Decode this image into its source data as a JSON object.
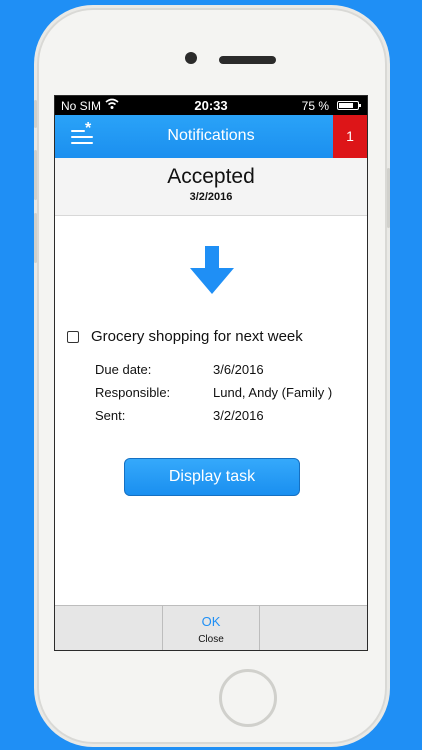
{
  "statusbar": {
    "carrier": "No SIM",
    "time": "20:33",
    "battery": "75 %"
  },
  "navbar": {
    "title": "Notifications",
    "badge": "1",
    "menu_icon": "menu-star-icon"
  },
  "notification": {
    "status": "Accepted",
    "date": "3/2/2016",
    "arrow_icon": "down-arrow-icon"
  },
  "task": {
    "title": "Grocery shopping for next week",
    "checked": false,
    "details": [
      {
        "label": "Due date:",
        "value": "3/6/2016"
      },
      {
        "label": "Responsible:",
        "value": "Lund, Andy (Family )"
      },
      {
        "label": "Sent:",
        "value": "3/2/2016"
      }
    ]
  },
  "actions": {
    "display_task": "Display task",
    "ok": "OK",
    "close": "Close"
  },
  "colors": {
    "background": "#1f8ff5",
    "accent": "#1f8ff5",
    "badge": "#dd1518"
  }
}
